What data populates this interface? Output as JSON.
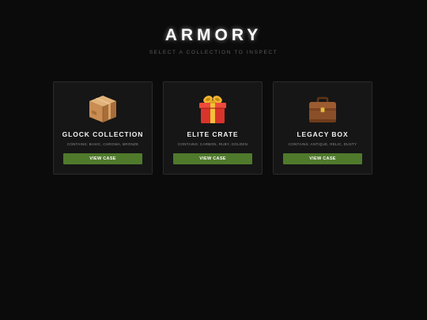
{
  "header": {
    "title": "ARMORY",
    "subtitle": "SELECT A COLLECTION TO INSPECT"
  },
  "colors": {
    "background": "#0b0b0b",
    "card": "#161616",
    "button": "#4f7a2c"
  },
  "cases": [
    {
      "icon": "package-box-icon",
      "title": "GLOCK COLLECTION",
      "contains": "CONTAINS: BASIC, CHROMA, BRONZE",
      "button_label": "VIEW CASE"
    },
    {
      "icon": "gift-box-icon",
      "title": "ELITE CRATE",
      "contains": "CONTAINS: CARBON, RUBY, GOLDEN",
      "button_label": "VIEW CASE"
    },
    {
      "icon": "briefcase-icon",
      "title": "LEGACY BOX",
      "contains": "CONTAINS: ANTIQUE, RELIC, DUSTY",
      "button_label": "VIEW CASE"
    }
  ]
}
